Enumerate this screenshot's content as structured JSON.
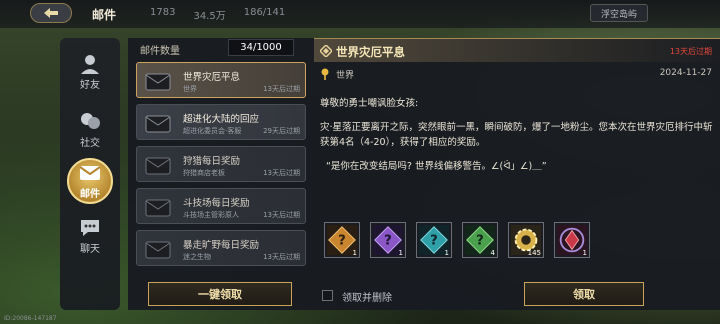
{
  "topbar": {
    "title": "邮件",
    "stats": [
      "1783",
      "34.5万",
      "186/141"
    ],
    "right_button": "浮空岛屿"
  },
  "nav": [
    {
      "label": "好友",
      "icon": "friend-icon"
    },
    {
      "label": "社交",
      "icon": "social-icon"
    },
    {
      "label": "邮件",
      "icon": "mail-icon",
      "active": true
    },
    {
      "label": "聊天",
      "icon": "chat-icon"
    }
  ],
  "mailbox": {
    "header_label": "邮件数量",
    "count": "34/1000",
    "claim_all_label": "一键领取",
    "items": [
      {
        "title": "世界灾厄平息",
        "sub": "世界",
        "time": "13天后过期",
        "active": true
      },
      {
        "title": "超进化大陆的回应",
        "sub": "超进化委员会·客服",
        "time": "29天后过期"
      },
      {
        "title": "狩猎每日奖励",
        "sub": "狩猎商店老板",
        "time": "13天后过期"
      },
      {
        "title": "斗技场每日奖励",
        "sub": "斗技场主管彩原人",
        "time": "13天后过期"
      },
      {
        "title": "暴走旷野每日奖励",
        "sub": "迷之生物",
        "time": "13天后过期"
      }
    ]
  },
  "detail": {
    "title": "世界灾厄平息",
    "expire": "13天后过期",
    "sender": "世界",
    "date": "2024-11-27",
    "greeting": "尊敬的勇士嘲讽脸女孩:",
    "paragraph": "灾·星落正要离开之际，突然眼前一黑，瞬间破防，爆了一地粉尘。您本次在世界灾厄排行中斩获第4名（4-20），获得了相应的奖励。",
    "quote": "“是你在改变结局吗? 世界线偏移警告。∠(ᐛ」∠)＿”",
    "rewards": [
      {
        "icon": "mystery-box-orange-icon",
        "qty": "1",
        "color": "#c9862f"
      },
      {
        "icon": "mystery-box-purple-icon",
        "qty": "1",
        "color": "#8a56c8"
      },
      {
        "icon": "mystery-box-teal-icon",
        "qty": "1",
        "color": "#2fa0a8"
      },
      {
        "icon": "mystery-box-green-icon",
        "qty": "4",
        "color": "#4aa04c"
      },
      {
        "icon": "gold-gear-icon",
        "qty": "145",
        "color": "#d8b14a"
      },
      {
        "icon": "red-crystal-icon",
        "qty": "1",
        "color": "#c83a48"
      }
    ],
    "claim_and_delete_label": "领取并删除",
    "claim_label": "领取"
  },
  "footer_id": "ID:20086-147187"
}
